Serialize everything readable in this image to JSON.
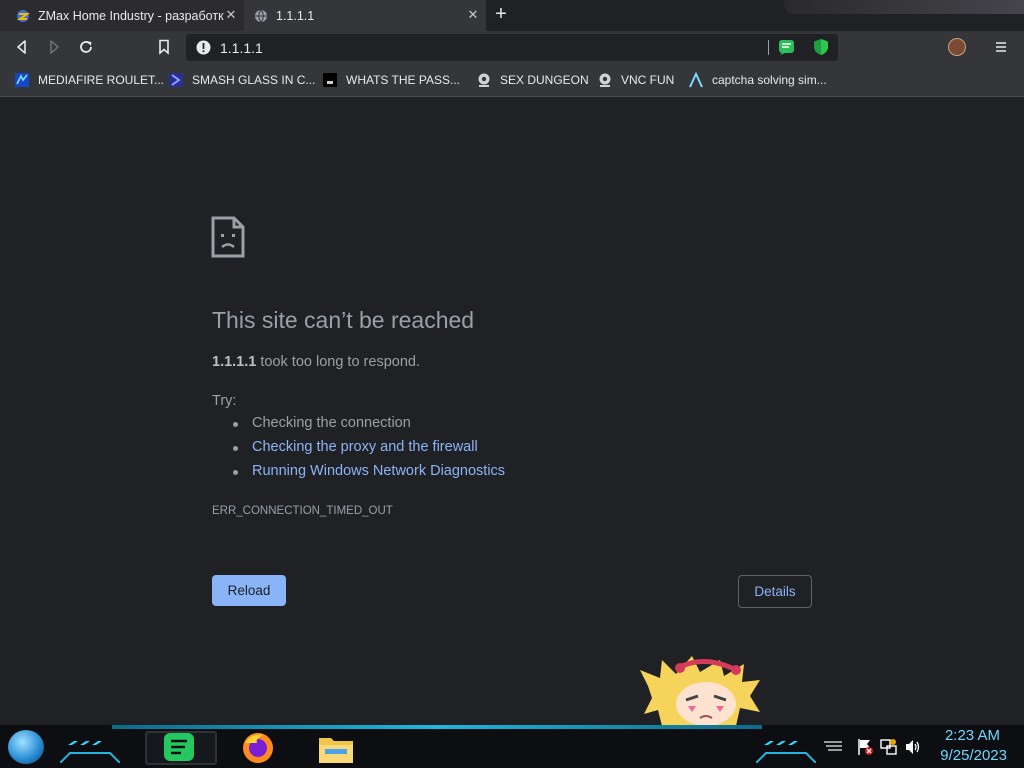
{
  "tabs": [
    {
      "title": "ZMax Home Industry - разработк",
      "active": false
    },
    {
      "title": "1.1.1.1",
      "active": true
    }
  ],
  "omnibox": {
    "url": "1.1.1.1"
  },
  "bookmarks": [
    {
      "label": "MEDIAFIRE ROULET...",
      "icon": "mediafire-icon"
    },
    {
      "label": "SMASH GLASS IN C...",
      "icon": "smash-glass-icon"
    },
    {
      "label": "WHATS THE PASS...",
      "icon": "terminal-icon"
    },
    {
      "label": "SEX DUNGEON",
      "icon": "gear-globe-icon"
    },
    {
      "label": "VNC FUN",
      "icon": "gear-globe-icon"
    },
    {
      "label": "captcha solving sim...",
      "icon": "lambda-icon"
    }
  ],
  "error": {
    "title": "This site can’t be reached",
    "host": "1.1.1.1",
    "desc_rest": " took too long to respond.",
    "try_label": "Try:",
    "suggestions": [
      "Checking the connection",
      "Checking the proxy and the firewall",
      "Running Windows Network Diagnostics"
    ],
    "code": "ERR_CONNECTION_TIMED_OUT",
    "reload_label": "Reload",
    "details_label": "Details"
  },
  "taskbar": {
    "time": "2:23 AM",
    "date": "9/25/2023",
    "pinned": [
      "spotify-icon",
      "firefox-icon",
      "file-explorer-icon"
    ]
  },
  "colors": {
    "page_bg": "#202124",
    "link": "#8ab4f8",
    "muted_text": "#9aa0a6",
    "clock": "#6fd8ff"
  }
}
